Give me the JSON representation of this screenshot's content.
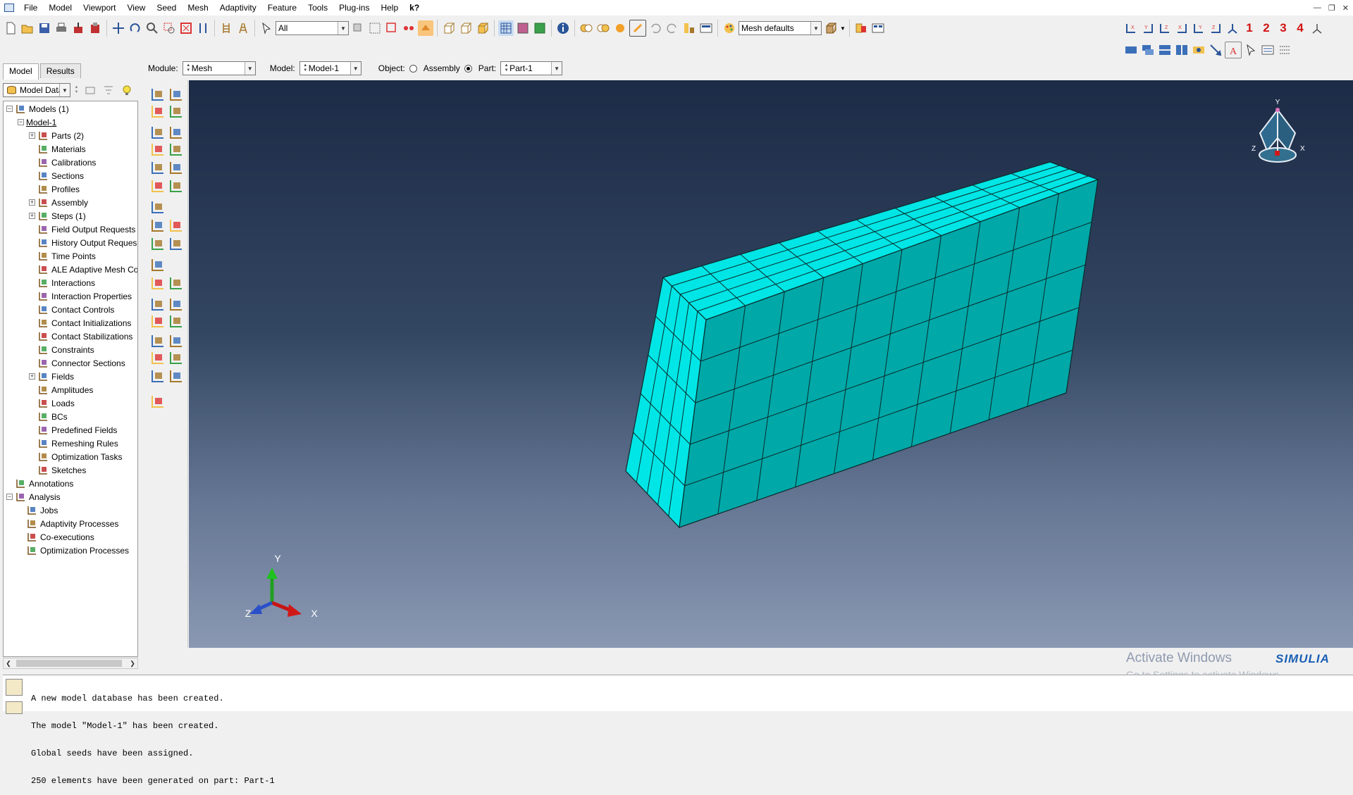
{
  "menu": [
    "File",
    "Model",
    "Viewport",
    "View",
    "Seed",
    "Mesh",
    "Adaptivity",
    "Feature",
    "Tools",
    "Plug-ins",
    "Help",
    "k?"
  ],
  "toolbar": {
    "selection_filter": "All",
    "mesh_defaults": "Mesh defaults",
    "viewport_numbers": [
      "1",
      "2",
      "3",
      "4"
    ]
  },
  "context": {
    "module_label": "Module:",
    "module_value": "Mesh",
    "model_label": "Model:",
    "model_value": "Model-1",
    "object_label": "Object:",
    "assembly_label": "Assembly",
    "part_label": "Part:",
    "part_value": "Part-1",
    "object_selected": "Part"
  },
  "tabs": [
    "Model",
    "Results"
  ],
  "tree_filter": "Model Data",
  "tree": [
    {
      "label": "Models (1)",
      "depth": 0,
      "expander": "minus",
      "icon": "models-icon"
    },
    {
      "label": "Model-1",
      "depth": 1,
      "expander": "minus",
      "icon": "",
      "underline": true
    },
    {
      "label": "Parts (2)",
      "depth": 2,
      "expander": "plus",
      "icon": "parts-icon"
    },
    {
      "label": "Materials",
      "depth": 2,
      "expander": "",
      "icon": "materials-icon"
    },
    {
      "label": "Calibrations",
      "depth": 2,
      "expander": "",
      "icon": "calibrations-icon"
    },
    {
      "label": "Sections",
      "depth": 2,
      "expander": "",
      "icon": "sections-icon"
    },
    {
      "label": "Profiles",
      "depth": 2,
      "expander": "",
      "icon": "profiles-icon"
    },
    {
      "label": "Assembly",
      "depth": 2,
      "expander": "plus",
      "icon": "assembly-icon"
    },
    {
      "label": "Steps (1)",
      "depth": 2,
      "expander": "plus",
      "icon": "steps-icon"
    },
    {
      "label": "Field Output Requests",
      "depth": 2,
      "expander": "",
      "icon": "field-output-icon"
    },
    {
      "label": "History Output Reques",
      "depth": 2,
      "expander": "",
      "icon": "history-output-icon"
    },
    {
      "label": "Time Points",
      "depth": 2,
      "expander": "",
      "icon": "time-points-icon"
    },
    {
      "label": "ALE Adaptive Mesh Co",
      "depth": 2,
      "expander": "",
      "icon": "ale-mesh-icon"
    },
    {
      "label": "Interactions",
      "depth": 2,
      "expander": "",
      "icon": "interactions-icon"
    },
    {
      "label": "Interaction Properties",
      "depth": 2,
      "expander": "",
      "icon": "interaction-properties-icon"
    },
    {
      "label": "Contact Controls",
      "depth": 2,
      "expander": "",
      "icon": "contact-controls-icon"
    },
    {
      "label": "Contact Initializations",
      "depth": 2,
      "expander": "",
      "icon": "contact-initializations-icon"
    },
    {
      "label": "Contact Stabilizations",
      "depth": 2,
      "expander": "",
      "icon": "contact-stabilizations-icon"
    },
    {
      "label": "Constraints",
      "depth": 2,
      "expander": "",
      "icon": "constraints-icon"
    },
    {
      "label": "Connector Sections",
      "depth": 2,
      "expander": "",
      "icon": "connector-sections-icon"
    },
    {
      "label": "Fields",
      "depth": 2,
      "expander": "plus",
      "icon": "fields-icon"
    },
    {
      "label": "Amplitudes",
      "depth": 2,
      "expander": "",
      "icon": "amplitudes-icon"
    },
    {
      "label": "Loads",
      "depth": 2,
      "expander": "",
      "icon": "loads-icon"
    },
    {
      "label": "BCs",
      "depth": 2,
      "expander": "",
      "icon": "bcs-icon"
    },
    {
      "label": "Predefined Fields",
      "depth": 2,
      "expander": "",
      "icon": "predefined-fields-icon"
    },
    {
      "label": "Remeshing Rules",
      "depth": 2,
      "expander": "",
      "icon": "remeshing-rules-icon"
    },
    {
      "label": "Optimization Tasks",
      "depth": 2,
      "expander": "",
      "icon": "optimization-tasks-icon"
    },
    {
      "label": "Sketches",
      "depth": 2,
      "expander": "",
      "icon": "sketches-icon"
    },
    {
      "label": "Annotations",
      "depth": 0,
      "expander": "",
      "icon": "annotations-icon"
    },
    {
      "label": "Analysis",
      "depth": 0,
      "expander": "minus",
      "icon": "analysis-icon"
    },
    {
      "label": "Jobs",
      "depth": 1,
      "expander": "",
      "icon": "jobs-icon"
    },
    {
      "label": "Adaptivity Processes",
      "depth": 1,
      "expander": "",
      "icon": "adaptivity-processes-icon"
    },
    {
      "label": "Co-executions",
      "depth": 1,
      "expander": "",
      "icon": "co-executions-icon"
    },
    {
      "label": "Optimization Processes",
      "depth": 1,
      "expander": "",
      "icon": "optimization-processes-icon"
    }
  ],
  "mesh": {
    "top_rows": 5,
    "top_cols": 10,
    "front_cols": 5,
    "front_rows": 5,
    "side_cols": 10,
    "side_rows": 5,
    "color": "#00e5e5"
  },
  "triad": {
    "x": "X",
    "y": "Y",
    "z": "Z"
  },
  "view_cube": {
    "x": "X",
    "y": "Y",
    "z": "Z"
  },
  "messages": [
    "A new model database has been created.",
    "The model \"Model-1\" has been created.",
    "Global seeds have been assigned.",
    "250 elements have been generated on part: Part-1"
  ],
  "watermark": {
    "title": "Activate Windows",
    "subtitle": "Go to Settings to activate Windows."
  },
  "brand": "SIMULIA"
}
